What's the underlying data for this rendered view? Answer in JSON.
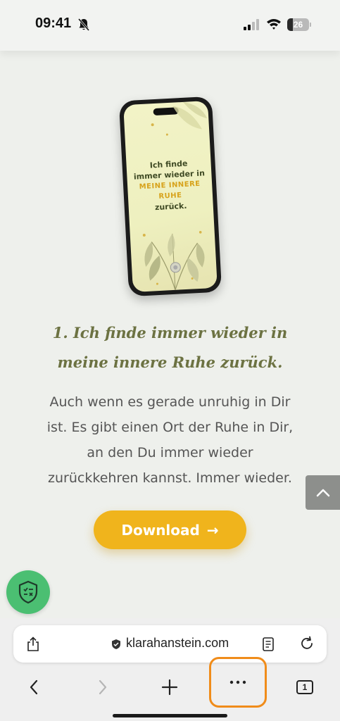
{
  "status_bar": {
    "time": "09:41",
    "battery_level": "26",
    "battery_fraction": 0.26,
    "icons": [
      "bell-off-icon",
      "signal-icon",
      "wifi-icon",
      "battery-icon"
    ]
  },
  "mockup": {
    "line1": "Ich finde",
    "line2": "immer wieder in",
    "line3": "MEINE INNERE",
    "line4": "RUHE",
    "line5": "zurück."
  },
  "content": {
    "heading_line1": "1. Ich finde immer wieder in",
    "heading_line2": "meine innere Ruhe zurück.",
    "body_line1": "Auch wenn es gerade unruhig in Dir",
    "body_line2": "ist. Es gibt einen Ort der Ruhe in Dir,",
    "body_line3": "an den Du immer wieder",
    "body_line4": "zurückkehren kannst. Immer wieder.",
    "download_label": "Download",
    "download_arrow": "→"
  },
  "browser": {
    "url": "klarahanstein.com",
    "tab_count": "1"
  },
  "colors": {
    "accent": "#f0b41c",
    "heading": "#6c7242",
    "badge": "#4bbf72",
    "highlight": "#f08c1a"
  }
}
